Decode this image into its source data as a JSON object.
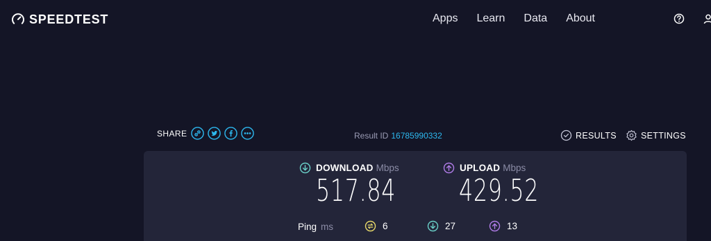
{
  "header": {
    "logo_text": "SPEEDTEST",
    "nav": [
      "Apps",
      "Learn",
      "Data",
      "About"
    ],
    "icons": [
      "help-icon",
      "user-icon"
    ]
  },
  "share": {
    "label": "SHARE",
    "buttons": [
      "link-icon",
      "twitter-icon",
      "facebook-icon",
      "more-icon"
    ]
  },
  "result": {
    "id_label": "Result ID",
    "id_value": "16785990332"
  },
  "links": {
    "results_label": "RESULTS",
    "settings_label": "SETTINGS"
  },
  "download": {
    "label": "DOWNLOAD",
    "unit": "Mbps",
    "value": "517.84"
  },
  "upload": {
    "label": "UPLOAD",
    "unit": "Mbps",
    "value": "429.52"
  },
  "ping": {
    "label": "Ping",
    "unit": "ms",
    "idle": "6",
    "download": "27",
    "upload": "13"
  },
  "colors": {
    "background": "#141526",
    "panel": "#232539",
    "accent_blue": "#2db8ef",
    "download": "#6ad0c8",
    "upload": "#b07ce8",
    "ping_idle": "#e8d96a"
  }
}
